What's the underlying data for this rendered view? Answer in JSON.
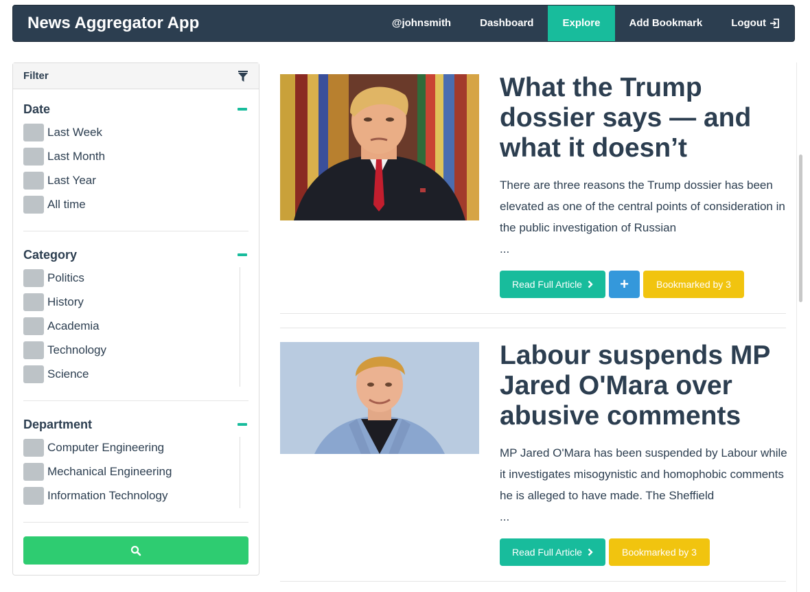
{
  "navbar": {
    "brand": "News Aggregator App",
    "items": [
      {
        "label": "@johnsmith",
        "active": false
      },
      {
        "label": "Dashboard",
        "active": false
      },
      {
        "label": "Explore",
        "active": true
      },
      {
        "label": "Add Bookmark",
        "active": false
      },
      {
        "label": "Logout",
        "active": false,
        "icon": "logout-icon"
      }
    ]
  },
  "filter": {
    "title": "Filter",
    "icon": "funnel-icon",
    "sections": [
      {
        "title": "Date",
        "options": [
          "Last Week",
          "Last Month",
          "Last Year",
          "All time"
        ]
      },
      {
        "title": "Category",
        "options": [
          "Politics",
          "History",
          "Academia",
          "Technology",
          "Science"
        ]
      },
      {
        "title": "Department",
        "options": [
          "Computer Engineering",
          "Mechanical Engineering",
          "Information Technology"
        ]
      }
    ],
    "search_icon": "search-icon"
  },
  "articles": [
    {
      "title": "What the Trump dossier says — and what it doesn’t",
      "summary": "There are three reasons the Trump dossier has been elevated as one of the central points of consideration in the public investigation of Russian",
      "ellipsis": "...",
      "read_label": "Read Full Article",
      "add_label": "+",
      "bookmark_label": "Bookmarked by 3"
    },
    {
      "title": "Labour suspends MP Jared O'Mara over abusive comments",
      "summary": "MP Jared O'Mara has been suspended by Labour while it investigates misogynistic and homophobic comments he is alleged to have made. The Sheffield",
      "ellipsis": "...",
      "read_label": "Read Full Article",
      "bookmark_label": "Bookmarked by 3"
    }
  ],
  "colors": {
    "navbar": "#2c3e50",
    "active": "#18bc9c",
    "primary_text": "#2c3e50",
    "bookmark": "#f1c40f",
    "add": "#3498db",
    "search": "#2ecc71"
  }
}
